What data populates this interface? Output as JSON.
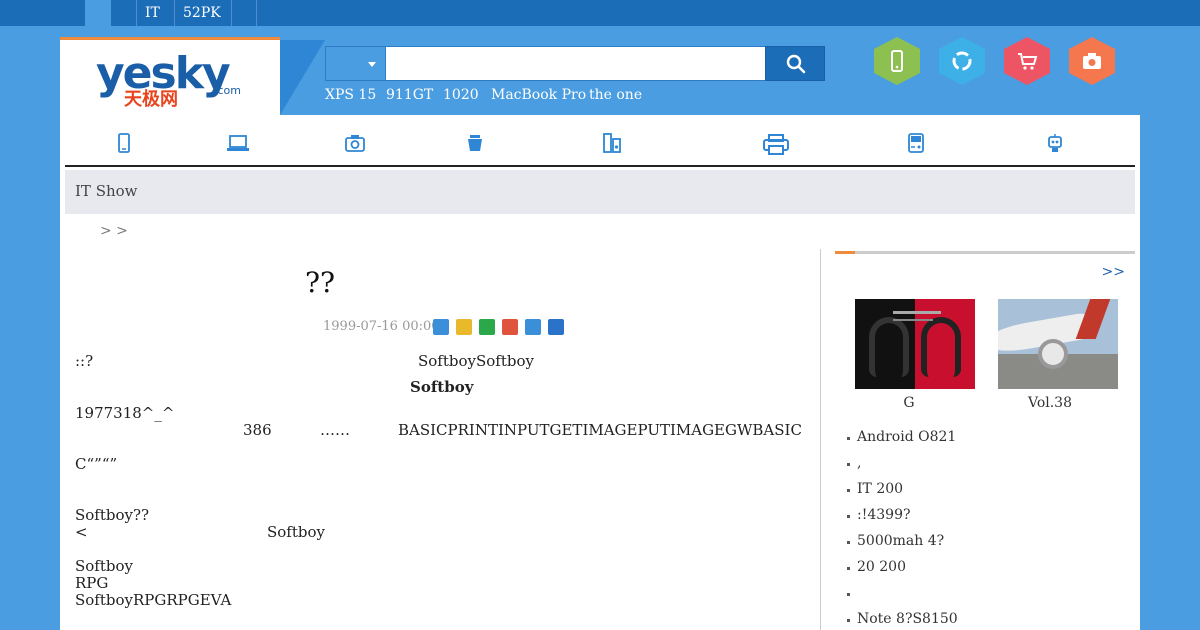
{
  "topbar": {
    "items": [
      "",
      "IT",
      "52PK",
      ""
    ]
  },
  "logo": {
    "main": "yesky",
    "cn": "天极网",
    "suffix": ".com"
  },
  "search": {
    "placeholder": "",
    "value": ""
  },
  "hotwords": [
    "XPS 15",
    "911GT",
    "1020",
    "MacBook Pro",
    "the one"
  ],
  "hexicons": [
    {
      "name": "phone-icon",
      "color": "#8cc152"
    },
    {
      "name": "refresh-icon",
      "color": "#3db0e8"
    },
    {
      "name": "cart-icon",
      "color": "#ed5565"
    },
    {
      "name": "camera-icon",
      "color": "#f5774e"
    }
  ],
  "nav": {
    "icons": [
      "mobile-icon",
      "laptop-icon",
      "camera-icon",
      "appliance-icon",
      "audio-icon",
      "printer-icon",
      "game-icon",
      "robot-icon"
    ]
  },
  "crumbbar": {
    "title": "IT Show"
  },
  "path": {
    "text": "> >"
  },
  "article": {
    "title": "??",
    "date": "1999-07-16 00:00",
    "share_icons": [
      "plus-share-icon",
      "qzone-icon",
      "wechat-icon",
      "weibo-icon",
      "pengyou-icon",
      "renren-icon"
    ],
    "lines": {
      "l1a": "::?",
      "l1b": "SoftboySoftboy",
      "l2": "Softboy",
      "l3": "1977318^_^",
      "l4a": "386",
      "l4b": "……",
      "l4c": "BASICPRINTINPUTGETIMAGEPUTIMAGEGWBASIC",
      "l5": "C“”“”",
      "l6": "Softboy??",
      "l7a": "<",
      "l7b": "Softboy",
      "l8": "Softboy",
      "l9": "RPG",
      "l10": "SoftboyRPGRPGEVA"
    }
  },
  "sidebar": {
    "more": ">>",
    "thumbs": [
      {
        "caption": "G"
      },
      {
        "caption": "Vol.38"
      }
    ],
    "list": [
      "Android O821",
      ",",
      "IT 200",
      ":!4399?",
      "5000mah 4?",
      "20 200",
      "",
      "Note 8?S8150"
    ]
  }
}
